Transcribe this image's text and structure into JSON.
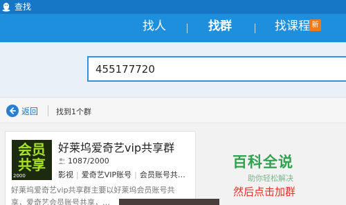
{
  "window": {
    "title": "查找"
  },
  "nav": {
    "tabs": [
      {
        "label": "找人",
        "active": false
      },
      {
        "label": "找群",
        "active": true
      },
      {
        "label": "找课程",
        "active": false,
        "badge": "新"
      }
    ]
  },
  "search": {
    "value": "455177720"
  },
  "results_bar": {
    "back_label": "返回",
    "count_text": "找到1个群"
  },
  "group_card": {
    "avatar_text_line1": "会员",
    "avatar_text_line2": "共享",
    "avatar_year": "2000",
    "name": "好莱坞爱奇艺vip共享群",
    "members": "1087/2000",
    "tags": [
      "影视",
      "爱奇艺VIP账号",
      "会员账号共…"
    ],
    "description_line1": "好莱坞爱奇艺vip共享群主要以好莱坞会员账号共",
    "description_line2": "享，爱奇艺会员账号共享，…"
  },
  "watermark": {
    "title": "百科全说",
    "subtitle": "助你轻松解决"
  },
  "annotation": {
    "text": "然后点击加群"
  },
  "colors": {
    "titlebar": "#1677c6",
    "navbar": "#1e8fdd",
    "search_bg": "#e9f0f7",
    "accent_blue": "#3590e0",
    "badge_orange": "#f07a1a",
    "watermark_green": "#2ea24e",
    "annotation_red": "#e53126"
  },
  "icons": [
    "qq-penguin-icon",
    "back-arrow-icon",
    "members-icon"
  ]
}
